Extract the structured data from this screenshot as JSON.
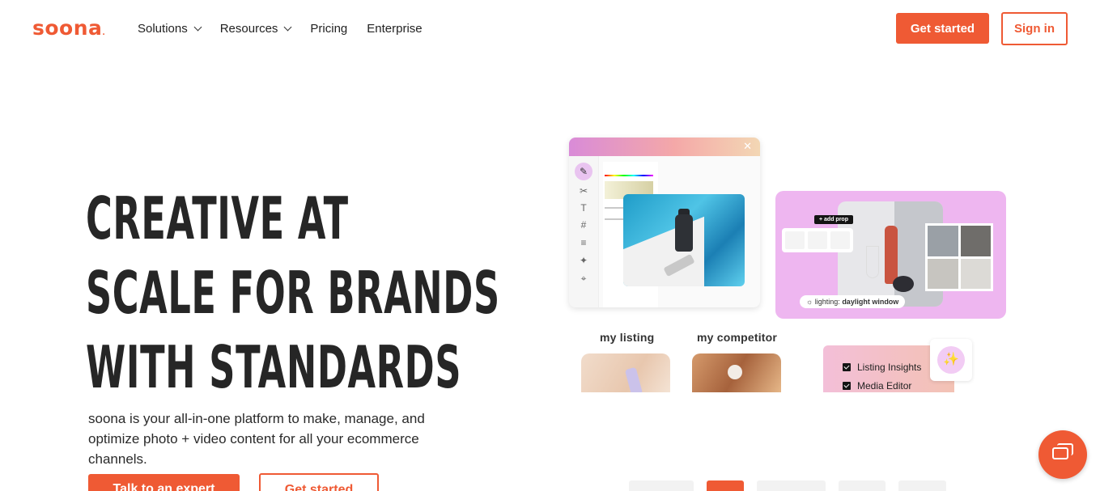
{
  "brand": {
    "name": "soona",
    "accent": "#ef5a34"
  },
  "nav": {
    "items": [
      {
        "label": "Solutions",
        "has_menu": true
      },
      {
        "label": "Resources",
        "has_menu": true
      },
      {
        "label": "Pricing",
        "has_menu": false
      },
      {
        "label": "Enterprise",
        "has_menu": false
      }
    ],
    "get_started": "Get started",
    "sign_in": "Sign in"
  },
  "hero": {
    "headline_lines": [
      "CREATIVE AT",
      "SCALE FOR BRANDS",
      "WITH STANDARDS"
    ],
    "subtitle": "soona is your all-in-one platform to make, manage, and optimize photo + video content for all your ecommerce channels.",
    "cta_primary": "Talk to an expert",
    "cta_secondary": "Get started"
  },
  "illustration": {
    "editor_close": "✕",
    "editor_tools": [
      "paint-icon",
      "scissors-icon",
      "text-icon",
      "grid-icon",
      "sliders-icon",
      "magic-icon",
      "crop-icon"
    ],
    "add_prop_label": "+ add prop",
    "lighting_label": "lighting:",
    "lighting_value": "daylight window",
    "my_listing_label": "my listing",
    "my_competitor_label": "my competitor",
    "insights": [
      "Listing Insights",
      "Media Editor"
    ],
    "wand_icon": "magic-wand-icon"
  },
  "carousel": {
    "tab_count": 6,
    "active_index": 1
  },
  "chat": {
    "icon": "chat-bubbles-icon"
  }
}
